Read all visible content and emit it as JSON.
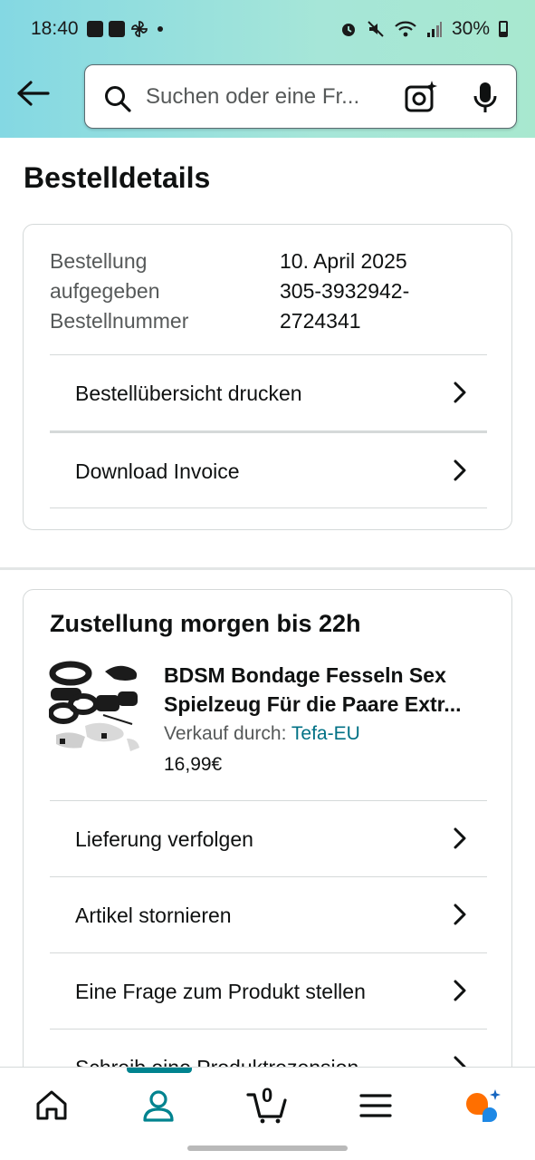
{
  "status": {
    "time": "18:40",
    "battery": "30%"
  },
  "search": {
    "placeholder": "Suchen oder eine Fr..."
  },
  "page": {
    "title": "Bestelldetails"
  },
  "order": {
    "label_placed": "Bestellung",
    "label_placed2": "aufgegeben",
    "label_number": "Bestellnummer",
    "date": "10. April 2025",
    "number_line1": "305-3932942-",
    "number_line2": "2724341",
    "actions": [
      {
        "label": "Bestellübersicht drucken"
      },
      {
        "label": "Download Invoice"
      }
    ]
  },
  "delivery": {
    "heading": "Zustellung morgen bis 22h",
    "product": {
      "title_line1": "BDSM Bondage Fesseln Sex",
      "title_line2": "Spielzeug Für die Paare Extr...",
      "seller_prefix": "Verkauf durch:",
      "seller_name": "Tefa-EU",
      "price": "16,99€"
    },
    "actions": [
      {
        "label": "Lieferung verfolgen"
      },
      {
        "label": "Artikel stornieren"
      },
      {
        "label": "Eine Frage zum Produkt stellen"
      },
      {
        "label": "Schreib eine Produktrezension"
      }
    ]
  },
  "bottomnav": {
    "cart_count": "0"
  },
  "colors": {
    "accent": "#00838f",
    "link": "#007185",
    "header_start": "#84d8e3",
    "header_end": "#a8e8cf"
  }
}
